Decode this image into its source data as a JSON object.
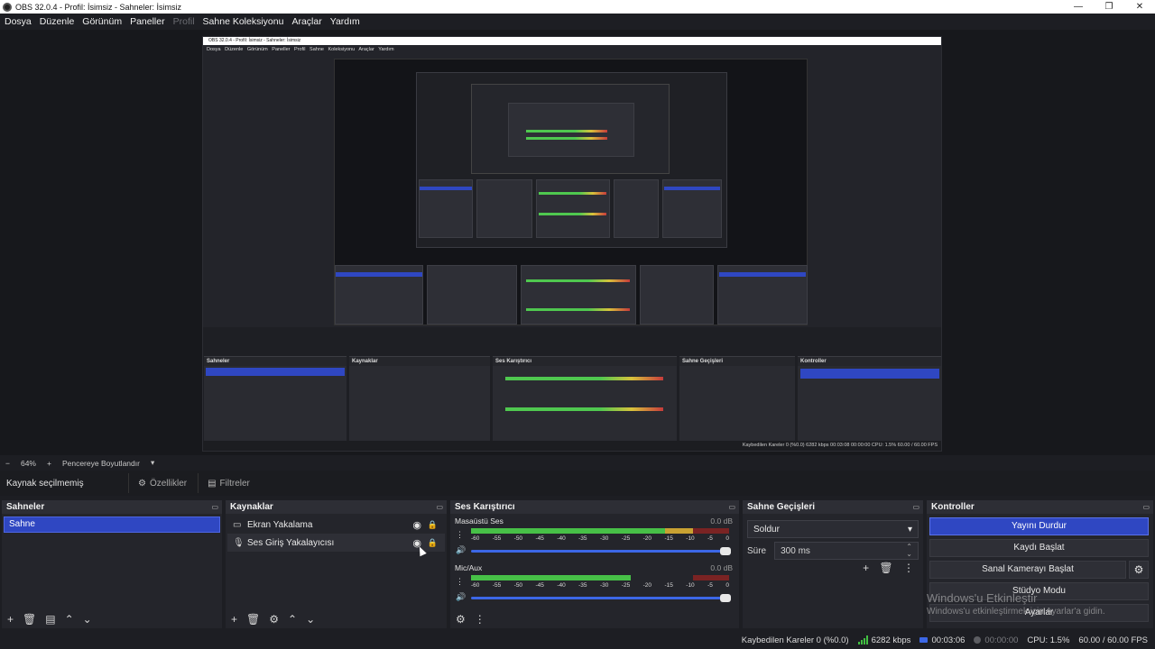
{
  "window": {
    "title": "OBS 32.0.4 - Profil: İsimsiz - Sahneler: İsimsiz",
    "controls": [
      "—",
      "❐",
      "✕"
    ]
  },
  "menu": [
    {
      "label": "Dosya",
      "disabled": false
    },
    {
      "label": "Düzenle",
      "disabled": false
    },
    {
      "label": "Görünüm",
      "disabled": false
    },
    {
      "label": "Paneller",
      "disabled": false
    },
    {
      "label": "Profil",
      "disabled": true
    },
    {
      "label": "Sahne Koleksiyonu",
      "disabled": false
    },
    {
      "label": "Araçlar",
      "disabled": false
    },
    {
      "label": "Yardım",
      "disabled": false
    }
  ],
  "preview": {
    "nested_title": "OBS 32.0.4 - Profil: İsimsiz - Sahneler: İsimsiz",
    "nested_menu": "Dosya Düzenle Görünüm Paneller Profil Sahne Koleksiyonu Araçlar Yardım",
    "nested_status": "Kaybedilen Kareler 0 (%0.0)   6282 kbps   00:03:08   00:00:00   CPU: 1.5%   60.00 / 60.00 FPS"
  },
  "zoom": {
    "minus": "−",
    "value": "64%",
    "plus": "+",
    "fit_label": "Pencereye Boyutlandır",
    "dropdown": "▾"
  },
  "source_toolbar": {
    "label": "Kaynak seçilmemiş",
    "properties": "Özellikler",
    "filters": "Filtreler"
  },
  "docks": {
    "scenes": {
      "title": "Sahneler",
      "items": [
        "Sahne"
      ]
    },
    "sources": {
      "title": "Kaynaklar",
      "items": [
        {
          "label": "Ekran Yakalama",
          "icon": "monitor-icon"
        },
        {
          "label": "Ses Giriş Yakalayıcısı",
          "icon": "microphone-icon"
        }
      ]
    },
    "mixer": {
      "title": "Ses Karıştırıcı",
      "ticks": [
        "-60",
        "-55",
        "-50",
        "-45",
        "-40",
        "-35",
        "-30",
        "-25",
        "-20",
        "-15",
        "-10",
        "-5",
        "0"
      ],
      "tracks": [
        {
          "name": "Masaüstü Ses",
          "db": "0.0 dB",
          "level": 0.92
        },
        {
          "name": "Mic/Aux",
          "db": "0.0 dB",
          "level": 0.62
        }
      ]
    },
    "transitions": {
      "title": "Sahne Geçişleri",
      "selected": "Soldur",
      "duration_label": "Süre",
      "duration_value": "300 ms"
    },
    "controls": {
      "title": "Kontroller",
      "stop_stream": "Yayını Durdur",
      "start_record": "Kaydı Başlat",
      "virtual_cam": "Sanal Kamerayı Başlat",
      "studio_mode": "Stüdyo Modu",
      "settings": "Ayarlar"
    }
  },
  "watermark": {
    "line1": "Windows'u Etkinleştir",
    "line2": "Windows'u etkinleştirmek için Ayarlar'a gidin."
  },
  "status": {
    "dropped": "Kaybedilen Kareler 0 (%0.0)",
    "bitrate": "6282 kbps",
    "stream_time": "00:03:06",
    "record_time": "00:00:00",
    "cpu": "CPU: 1.5%",
    "fps": "60.00 / 60.00 FPS"
  },
  "colors": {
    "accent": "#2f47c2",
    "meter_green": "#47c047",
    "meter_yellow": "#c9a232",
    "meter_red": "#7a2323",
    "slider_blue": "#3c67e6"
  }
}
